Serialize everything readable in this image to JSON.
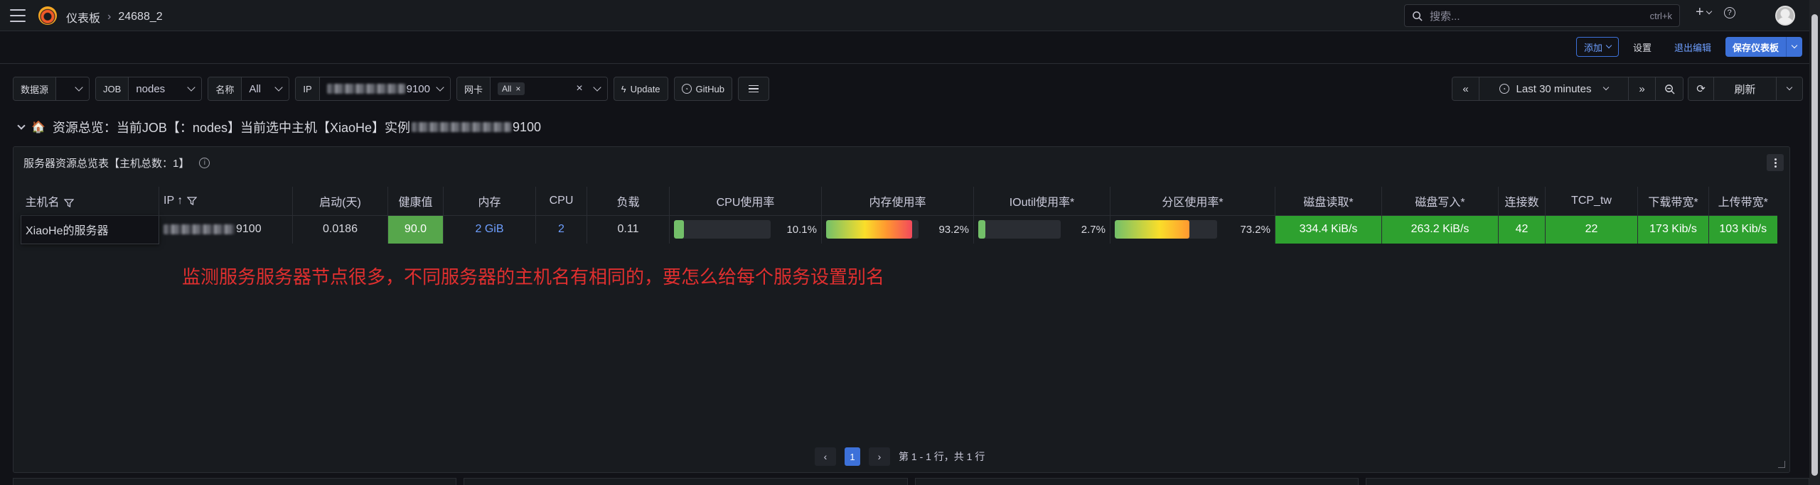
{
  "nav": {
    "breadcrumb_root": "仪表板",
    "breadcrumb_current": "24688_2",
    "search_placeholder": "搜索...",
    "search_shortcut": "ctrl+k",
    "plus_label": "+"
  },
  "actions": {
    "add_label": "添加",
    "settings_label": "设置",
    "exit_edit_label": "退出编辑",
    "save_label": "保存仪表板"
  },
  "vars": {
    "datasource_label": "数据源",
    "job_label": "JOB",
    "job_value": "nodes",
    "name_label": "名称",
    "name_value": "All",
    "ip_label": "IP",
    "ip_suffix": "9100",
    "nic_label": "网卡",
    "nic_chip": "All",
    "update_label": "Update",
    "github_label": "GitHub"
  },
  "time": {
    "range_label": "Last 30 minutes",
    "refresh_label": "刷新"
  },
  "row": {
    "title_prefix": "资源总览：当前JOB【：nodes】当前选中主机【XiaoHe】实例",
    "title_suffix": "9100"
  },
  "panel": {
    "title": "服务器资源总览表【主机总数：1】",
    "columns": [
      "主机名",
      "IP",
      "启动(天)",
      "健康值",
      "内存",
      "CPU",
      "负载",
      "CPU使用率",
      "内存使用率",
      "IOutil使用率*",
      "分区使用率*",
      "磁盘读取*",
      "磁盘写入*",
      "连接数",
      "TCP_tw",
      "下载带宽*",
      "上传带宽*"
    ],
    "row": {
      "hostname": "XiaoHe的服务器",
      "ip_suffix": "9100",
      "uptime": "0.0186",
      "health": "90.0",
      "memory": "2 GiB",
      "cpu": "2",
      "load": "0.11",
      "cpu_usage": "10.1%",
      "cpu_usage_value": 10.1,
      "mem_usage": "93.2%",
      "mem_usage_value": 93.2,
      "io_usage": "2.7%",
      "io_usage_value": 2.7,
      "part_usage": "73.2%",
      "part_usage_value": 73.2,
      "disk_read": "334.4 KiB/s",
      "disk_write": "263.2 KiB/s",
      "connections": "42",
      "tcp_tw": "22",
      "download": "173 Kib/s",
      "upload": "103 Kib/s"
    },
    "pagination": {
      "current": "1",
      "summary": "第 1 - 1 行，共 1 行"
    }
  },
  "annotation": "监测服务服务器节点很多，不同服务器的主机名有相同的，要怎么给每个服务设置别名",
  "colors": {
    "accent": "#3d71d9",
    "green": "#2ea12f",
    "annotation_red": "#e02f2f"
  }
}
